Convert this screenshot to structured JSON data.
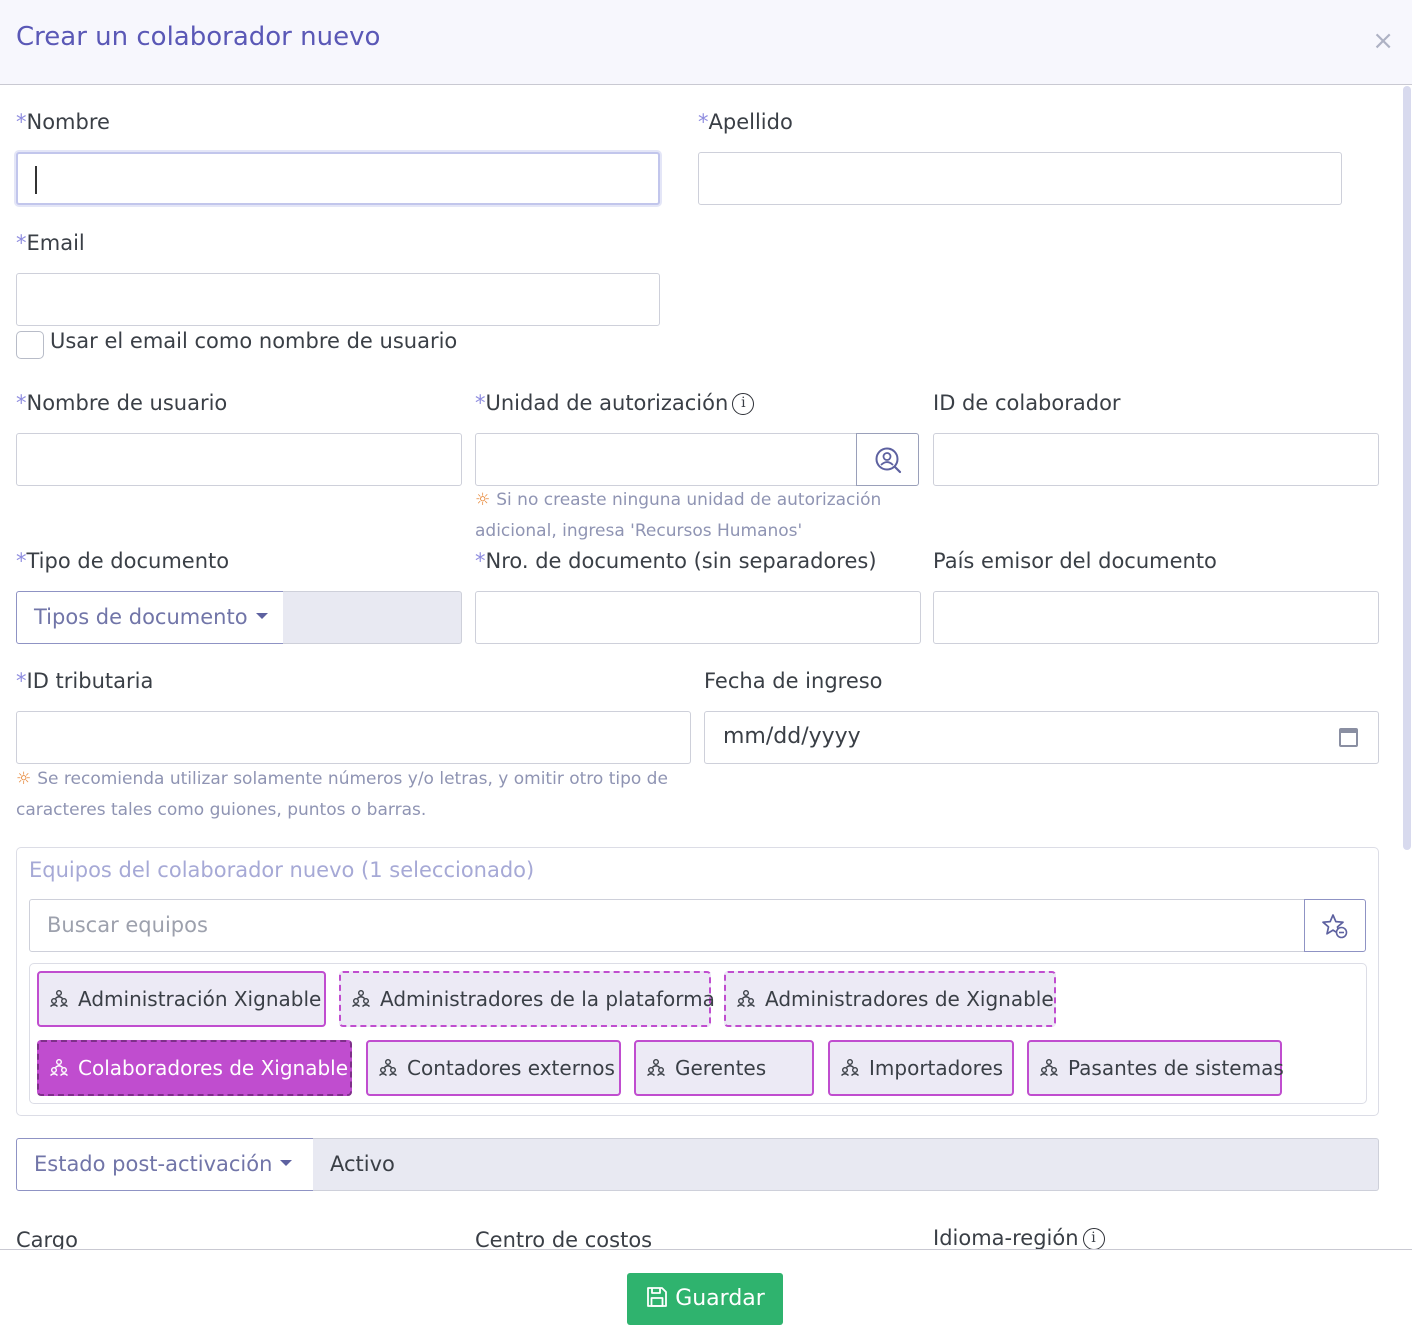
{
  "dialog": {
    "title": "Crear un colaborador nuevo",
    "close_symbol": "×"
  },
  "required_mark": "*",
  "fields": {
    "nombre": {
      "label": "Nombre",
      "value": ""
    },
    "apellido": {
      "label": "Apellido",
      "value": ""
    },
    "email": {
      "label": "Email",
      "value": ""
    },
    "use_email_checkbox": {
      "label": "Usar el email como nombre de usuario",
      "checked": false
    },
    "username": {
      "label": "Nombre de usuario",
      "value": ""
    },
    "auth_unit": {
      "label": "Unidad de autorización",
      "value": "",
      "hint": "Si no creaste ninguna unidad de autorización adicional, ingresa 'Recursos Humanos'"
    },
    "collaborator_id": {
      "label": "ID de colaborador",
      "value": ""
    },
    "doc_type": {
      "label": "Tipo de documento",
      "dropdown": "Tipos de documento"
    },
    "doc_number": {
      "label": "Nro. de documento (sin separadores)",
      "value": ""
    },
    "doc_country": {
      "label": "País emisor del documento",
      "value": ""
    },
    "tax_id": {
      "label": "ID tributaria",
      "value": "",
      "hint": "Se recomienda utilizar solamente números y/o letras, y omitir otro tipo de caracteres tales como guiones, puntos o barras."
    },
    "start_date": {
      "label": "Fecha de ingreso",
      "placeholder": "mm/dd/yyyy"
    }
  },
  "teams": {
    "title": "Equipos del colaborador nuevo (1 seleccionado)",
    "search_placeholder": "Buscar equipos",
    "chips": [
      {
        "label": "Administración Xignable",
        "style": "solid"
      },
      {
        "label": "Administradores de la plataforma",
        "style": "dashed"
      },
      {
        "label": "Administradores de Xignable",
        "style": "dashed"
      },
      {
        "label": "Colaboradores de Xignable",
        "style": "selected"
      },
      {
        "label": "Contadores externos",
        "style": "solid"
      },
      {
        "label": "Gerentes",
        "style": "solid"
      },
      {
        "label": "Importadores",
        "style": "solid"
      },
      {
        "label": "Pasantes de sistemas",
        "style": "solid"
      }
    ]
  },
  "post_activation": {
    "dropdown": "Estado post-activación",
    "value": "Activo"
  },
  "bottom_labels": {
    "cargo": "Cargo",
    "cost_center": "Centro de costos",
    "language": "Idioma-región"
  },
  "footer": {
    "save_label": "Guardar"
  },
  "colors": {
    "accent": "#5a58b6",
    "chip_border": "#c04dcf",
    "save": "#2fb36e",
    "hint_icon": "#e8893b"
  }
}
